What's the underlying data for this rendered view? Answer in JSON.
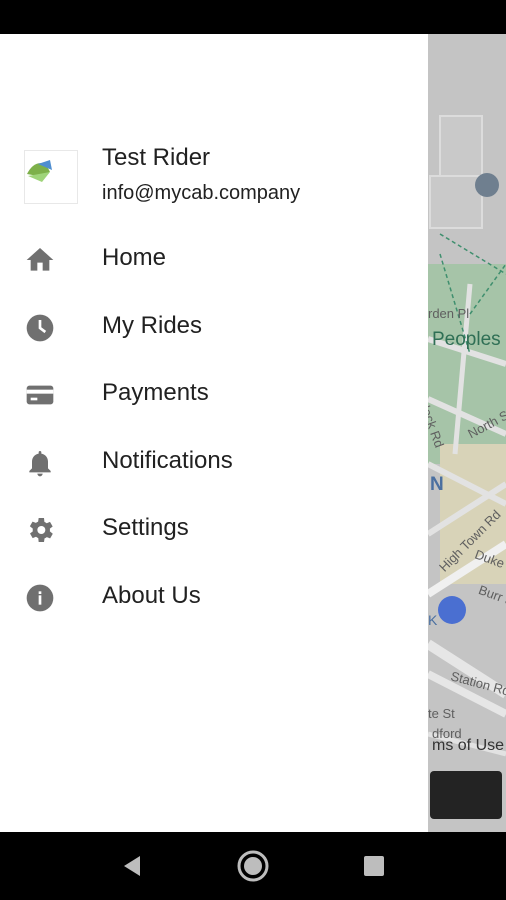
{
  "user": {
    "name": "Test Rider",
    "email": "info@mycab.company"
  },
  "menu": [
    {
      "label": "Home",
      "icon": "home-icon"
    },
    {
      "label": "My Rides",
      "icon": "clock-icon"
    },
    {
      "label": "Payments",
      "icon": "credit-card-icon"
    },
    {
      "label": "Notifications",
      "icon": "bell-icon"
    },
    {
      "label": "Settings",
      "icon": "gear-icon"
    },
    {
      "label": "About Us",
      "icon": "info-icon"
    }
  ],
  "map": {
    "labels": {
      "peoples": "Peoples",
      "arden_pl": "rden Pl",
      "havelock_rd": "avelock Rd",
      "north_st": "North St",
      "high_town_rd": "High Town Rd",
      "duke_st": "Duke St",
      "burr_st": "Burr S",
      "station_rd": "Station Rd",
      "te_st": "te St",
      "dford": "dford",
      "n_letter": "N",
      "k_letter": "K"
    },
    "terms": "ms of Use"
  },
  "colors": {
    "drawer_bg": "#ffffff",
    "scrim_map": "#c9c9c9",
    "icon_gray": "#707070",
    "text": "#212121",
    "park_green": "#a6c4a8",
    "parking_pin": "#4a6fd1"
  }
}
